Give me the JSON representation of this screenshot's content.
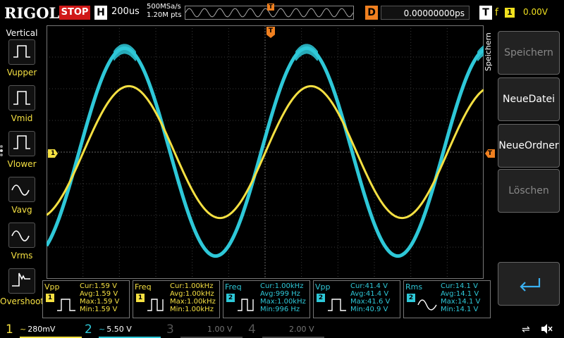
{
  "header": {
    "brand": "RIGOL",
    "run_state": "STOP",
    "h_label": "H",
    "timebase": "200us",
    "sample_rate": "500MSa/s",
    "memory_depth": "1.20M pts",
    "delay_label": "D",
    "delay_value": "0.00000000ps",
    "trigger_label": "T",
    "trigger_edge": "f",
    "trigger_source": "1",
    "trigger_level": "0.00V",
    "trigger_marker": "T"
  },
  "left_panel": {
    "title": "Vertical",
    "items": [
      {
        "label": "Vupper",
        "icon": "vupper-icon"
      },
      {
        "label": "Vmid",
        "icon": "vmid-icon"
      },
      {
        "label": "Vlower",
        "icon": "vlower-icon"
      },
      {
        "label": "Vavg",
        "icon": "vavg-icon"
      },
      {
        "label": "Vrms",
        "icon": "vrms-icon"
      },
      {
        "label": "Overshoot",
        "icon": "overshoot-icon"
      }
    ]
  },
  "right_panel": {
    "side_label": "Speichern",
    "buttons": [
      {
        "label": "Speichern",
        "enabled": false
      },
      {
        "label": "NeueDatei",
        "enabled": true
      },
      {
        "label": "NeueOrdner",
        "enabled": true
      },
      {
        "label": "Löschen",
        "enabled": false
      },
      {
        "label": "",
        "enabled": true,
        "icon": "return-icon"
      }
    ]
  },
  "markers": {
    "ch1_left": "1",
    "ch1_right": "T"
  },
  "measurements": [
    {
      "name": "Vpp",
      "channel": "1",
      "cur": "Cur:1.59 V",
      "avg": "Avg:1.59 V",
      "max": "Max:1.59 V",
      "min": "Min:1.59 V"
    },
    {
      "name": "Freq",
      "channel": "1",
      "cur": "Cur:1.00kHz",
      "avg": "Avg:1.00kHz",
      "max": "Max:1.00kHz",
      "min": "Min:1.00kHz"
    },
    {
      "name": "Freq",
      "channel": "2",
      "cur": "Cur:1.00kHz",
      "avg": "Avg:999 Hz",
      "max": "Max:1.00kHz",
      "min": "Min:996 Hz"
    },
    {
      "name": "Vpp",
      "channel": "2",
      "cur": "Cur:41.4 V",
      "avg": "Avg:41.4 V",
      "max": "Max:41.6 V",
      "min": "Min:40.9 V"
    },
    {
      "name": "Rms",
      "channel": "2",
      "cur": "Cur:14.1 V",
      "avg": "Avg:14.1 V",
      "max": "Max:14.1 V",
      "min": "Min:14.1 V"
    }
  ],
  "channels": [
    {
      "num": "1",
      "coupling": "~",
      "scale": "280mV",
      "color": "#f5e042",
      "active": true
    },
    {
      "num": "2",
      "coupling": "~",
      "scale": "5.50 V",
      "color": "#2ec8d8",
      "active": true
    },
    {
      "num": "3",
      "coupling": "",
      "scale": "1.00 V",
      "color": "#555555",
      "active": false
    },
    {
      "num": "4",
      "coupling": "",
      "scale": "2.00 V",
      "color": "#555555",
      "active": false
    }
  ],
  "colors": {
    "ch1": "#f5e042",
    "ch2": "#2ec8d8",
    "trigger": "#f08020",
    "stop": "#d01818",
    "grid": "#3a3a3a"
  },
  "waveforms": {
    "ch1": {
      "shape": "sine",
      "periods_visible": 2.4,
      "amplitude_fraction": 0.52
    },
    "ch2": {
      "shape": "sine",
      "periods_visible": 2.4,
      "amplitude_fraction": 0.82,
      "top_noise": true
    }
  }
}
